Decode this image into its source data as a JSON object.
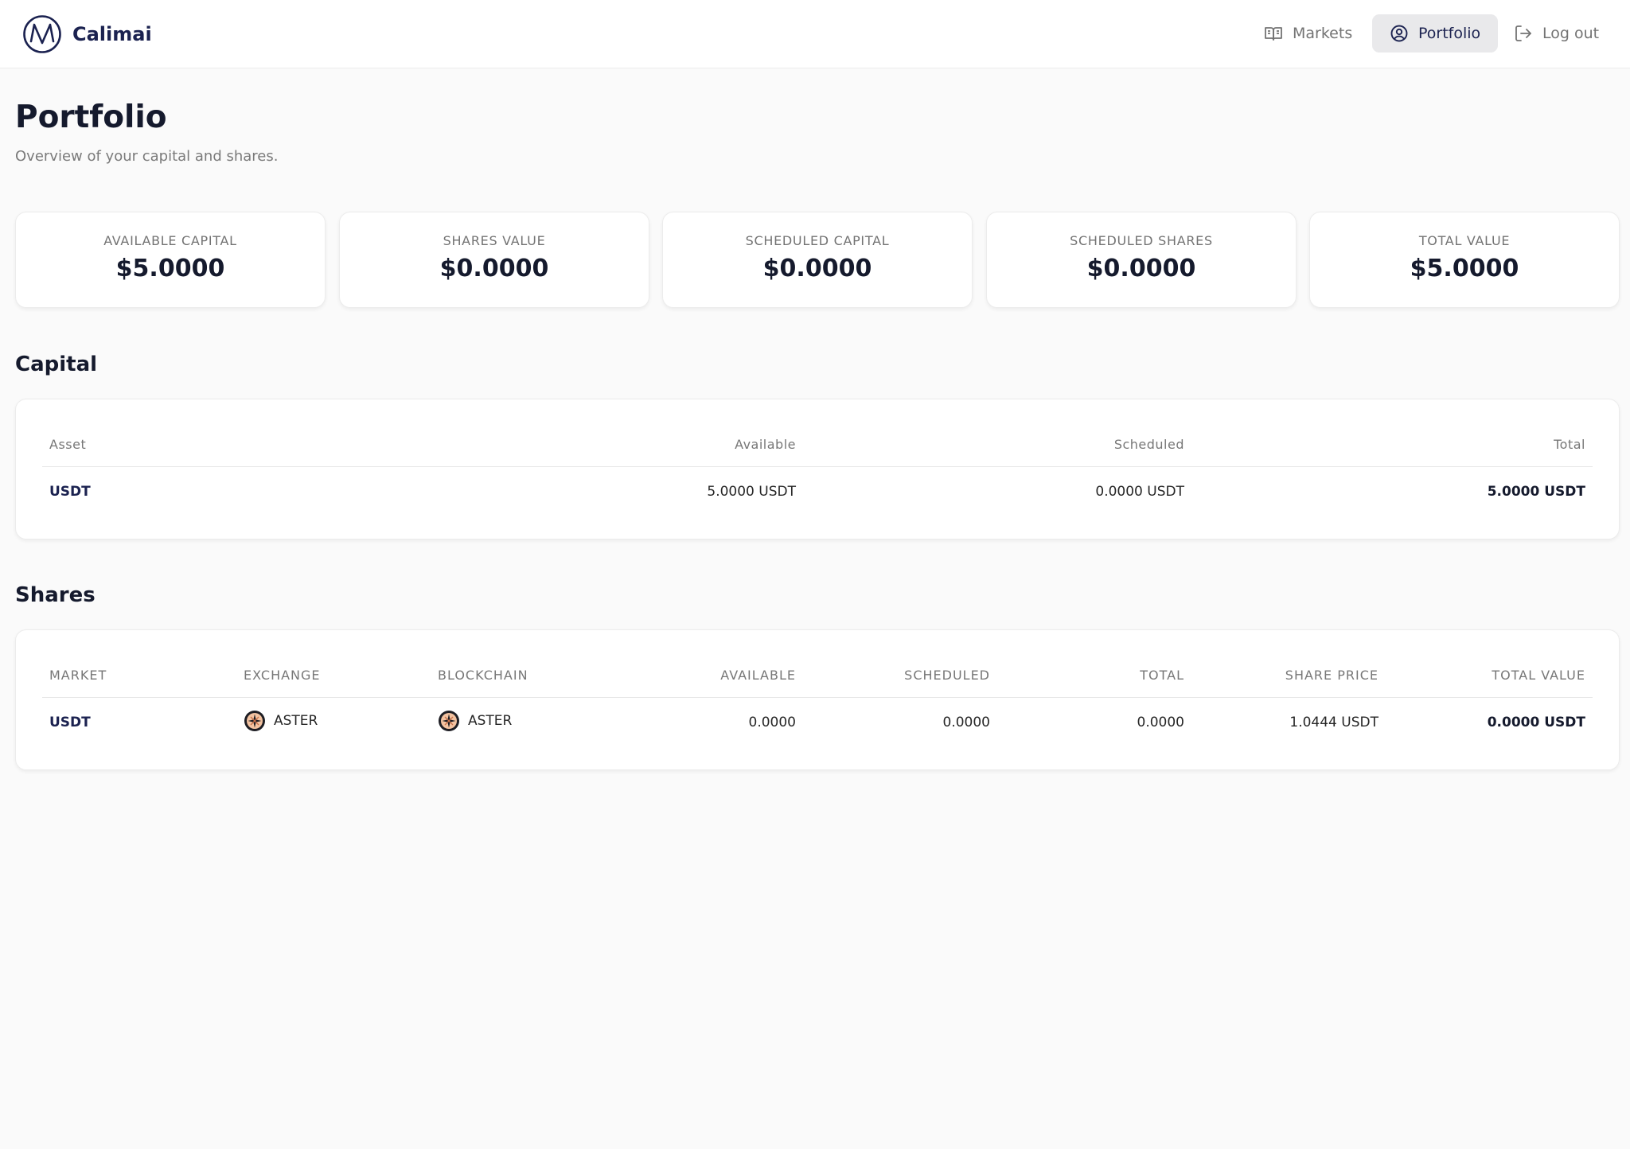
{
  "app": {
    "brand_name": "Calimai"
  },
  "nav": {
    "markets": "Markets",
    "portfolio": "Portfolio",
    "logout": "Log out"
  },
  "page": {
    "title": "Portfolio",
    "subtitle": "Overview of your capital and shares."
  },
  "stats": [
    {
      "label": "AVAILABLE CAPITAL",
      "value": "$5.0000"
    },
    {
      "label": "SHARES VALUE",
      "value": "$0.0000"
    },
    {
      "label": "SCHEDULED CAPITAL",
      "value": "$0.0000"
    },
    {
      "label": "SCHEDULED SHARES",
      "value": "$0.0000"
    },
    {
      "label": "TOTAL VALUE",
      "value": "$5.0000"
    }
  ],
  "capital": {
    "title": "Capital",
    "headers": {
      "asset": "Asset",
      "available": "Available",
      "scheduled": "Scheduled",
      "total": "Total"
    },
    "rows": [
      {
        "asset": "USDT",
        "available": "5.0000 USDT",
        "scheduled": "0.0000 USDT",
        "total": "5.0000 USDT"
      }
    ]
  },
  "shares": {
    "title": "Shares",
    "headers": {
      "market": "MARKET",
      "exchange": "EXCHANGE",
      "blockchain": "BLOCKCHAIN",
      "available": "AVAILABLE",
      "scheduled": "SCHEDULED",
      "total": "TOTAL",
      "share_price": "SHARE PRICE",
      "total_value": "TOTAL VALUE"
    },
    "rows": [
      {
        "market": "USDT",
        "exchange": "ASTER",
        "exchange_icon": "aster-logo-icon",
        "blockchain": "ASTER",
        "blockchain_icon": "aster-logo-icon",
        "available": "0.0000",
        "scheduled": "0.0000",
        "total": "0.0000",
        "share_price": "1.0444 USDT",
        "total_value": "0.0000 USDT"
      }
    ]
  },
  "colors": {
    "brand": "#1b2250",
    "background": "#fafafa",
    "card": "#ffffff",
    "muted_text": "#737373",
    "active_nav_bg": "#e9e9eb"
  }
}
